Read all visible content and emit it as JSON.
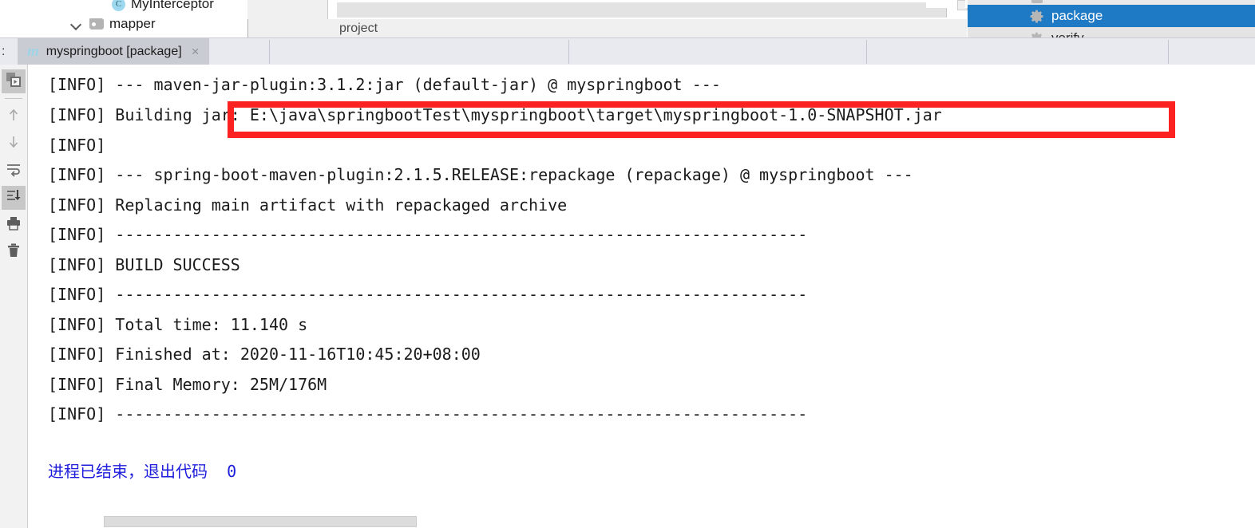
{
  "project_tree": {
    "items": [
      {
        "label": "MyInterceptor",
        "icon": "java-class-icon"
      },
      {
        "label": "mapper",
        "icon": "folder-icon"
      }
    ]
  },
  "panels": {
    "project_label": "project"
  },
  "maven_goals_popup": {
    "items": [
      {
        "label": "package",
        "icon": "gear-icon",
        "selected": true
      },
      {
        "label": "verify",
        "icon": "gear-icon",
        "selected": false
      }
    ],
    "selected_bg": "#1e7ac4",
    "selected_fg": "#ffffff"
  },
  "tabbar": {
    "prefix": ":",
    "tab": {
      "icon": "maven-icon",
      "label": "myspringboot [package]",
      "close": "×"
    }
  },
  "gutter": {
    "buttons": [
      {
        "name": "rerun-icon",
        "active": true
      },
      {
        "name": "arrow-up-icon",
        "active": false
      },
      {
        "name": "arrow-down-icon",
        "active": false
      },
      {
        "name": "soft-wrap-icon",
        "active": false
      },
      {
        "name": "scroll-to-end-icon",
        "active": true
      },
      {
        "name": "print-icon",
        "active": false
      },
      {
        "name": "trash-icon",
        "active": false
      }
    ]
  },
  "console": {
    "lines": [
      "[INFO] --- maven-jar-plugin:3.1.2:jar (default-jar) @ myspringboot ---",
      "[INFO] Building jar: E:\\java\\springbootTest\\myspringboot\\target\\myspringboot-1.0-SNAPSHOT.jar",
      "[INFO]",
      "[INFO] --- spring-boot-maven-plugin:2.1.5.RELEASE:repackage (repackage) @ myspringboot ---",
      "[INFO] Replacing main artifact with repackaged archive",
      "[INFO] ------------------------------------------------------------------------",
      "[INFO] BUILD SUCCESS",
      "[INFO] ------------------------------------------------------------------------",
      "[INFO] Total time: 11.140 s",
      "[INFO] Finished at: 2020-11-16T10:45:20+08:00",
      "[INFO] Final Memory: 25M/176M",
      "[INFO] ------------------------------------------------------------------------"
    ],
    "exit_message": "进程已结束，退出代码  0",
    "exit_color": "#1d1ddb",
    "text_color": "#1b1b1b",
    "highlight_color": "#fc2222"
  }
}
